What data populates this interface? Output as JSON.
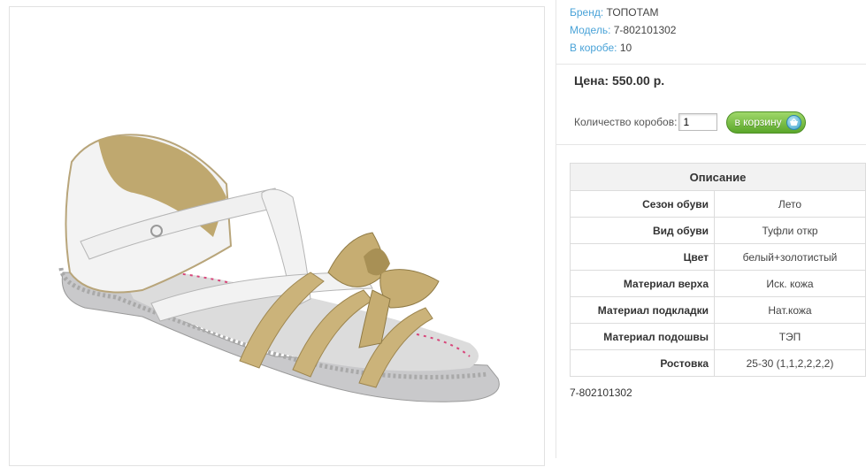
{
  "product": {
    "image_alt": "product-photo-sandal",
    "brand_label": "Бренд:",
    "brand_value": "ТОПОТАМ",
    "model_label": "Модель:",
    "model_value": "7-802101302",
    "box_label": "В коробе:",
    "box_value": "10",
    "price": "Цена: 550.00 р.",
    "quantity_label": "Количество коробов:",
    "quantity_value": "1",
    "cart_button": "в корзину",
    "sku_footer": "7-802101302"
  },
  "description": {
    "title": "Описание",
    "rows": [
      {
        "key": "Сезон обуви",
        "value": "Лето"
      },
      {
        "key": "Вид обуви",
        "value": "Туфли откр"
      },
      {
        "key": "Цвет",
        "value": "белый+золотистый"
      },
      {
        "key": "Материал верха",
        "value": "Иск. кожа"
      },
      {
        "key": "Материал подкладки",
        "value": "Нат.кожа"
      },
      {
        "key": "Материал подошвы",
        "value": "ТЭП"
      },
      {
        "key": "Ростовка",
        "value": "25-30 (1,1,2,2,2,2)"
      }
    ]
  },
  "colors": {
    "link": "#4aa3d8",
    "button_green": "#5aa62a",
    "border": "#dcdcdc"
  },
  "icons": {
    "cart": "basket-icon"
  }
}
